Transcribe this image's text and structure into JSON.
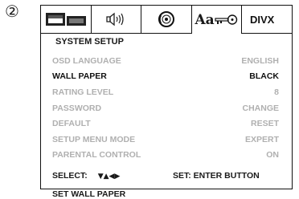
{
  "step_number": "②",
  "tabs": [
    {
      "icon": "video-display-icon",
      "active": false
    },
    {
      "icon": "audio-speaker-icon",
      "active": false
    },
    {
      "icon": "disc-icon",
      "active": false
    },
    {
      "icon": "language-key-icon",
      "label": "Aa",
      "active": true
    },
    {
      "icon": "divx-icon",
      "label": "DIVX",
      "active": false
    }
  ],
  "panel": {
    "title": "SYSTEM SETUP",
    "rows": [
      {
        "label": "OSD LANGUAGE",
        "value": "ENGLISH",
        "selected": false
      },
      {
        "label": "WALL PAPER",
        "value": "BLACK",
        "selected": true
      },
      {
        "label": "RATING LEVEL",
        "value": "8",
        "selected": false
      },
      {
        "label": "PASSWORD",
        "value": "CHANGE",
        "selected": false
      },
      {
        "label": "DEFAULT",
        "value": "RESET",
        "selected": false
      },
      {
        "label": "SETUP MENU MODE",
        "value": "EXPERT",
        "selected": false
      },
      {
        "label": "PARENTAL CONTROL",
        "value": "ON",
        "selected": false
      }
    ],
    "select_label": "SELECT:",
    "select_arrows": "▼▲◀▶",
    "set_label": "SET: ENTER BUTTON",
    "help_text": "SET WALL PAPER"
  }
}
